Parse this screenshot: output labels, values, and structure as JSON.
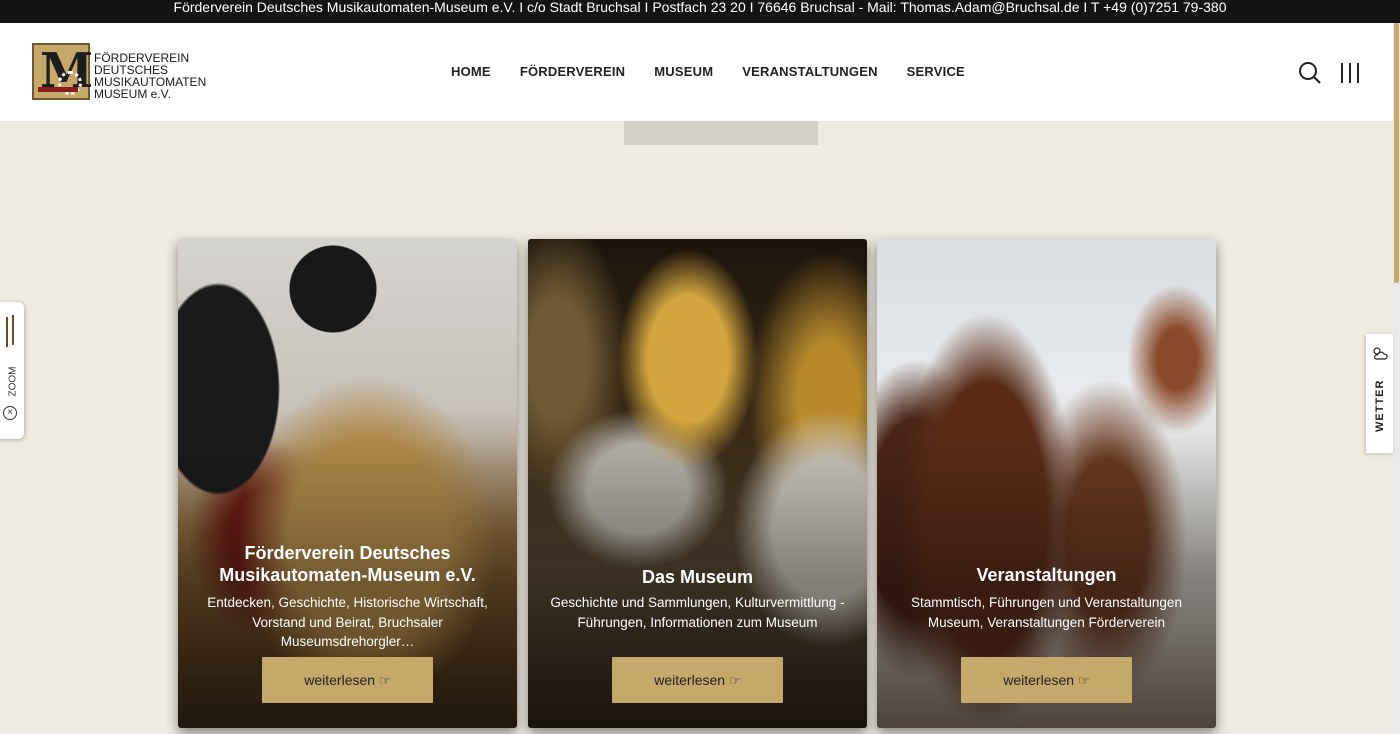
{
  "topbar": {
    "text": "Förderverein Deutsches Musikautomaten-Museum e.V. I c/o Stadt Bruchsal I Postfach 23 20 I 76646 Bruchsal - Mail: Thomas.Adam@Bruchsal.de I T +49 (0)7251 79-380"
  },
  "logo": {
    "line1": "FÖRDERVEREIN",
    "line2": "DEUTSCHES",
    "line3": "MUSIKAUTOMATEN",
    "line4": "MUSEUM e.V."
  },
  "nav": {
    "items": [
      "HOME",
      "FÖRDERVEREIN",
      "MUSEUM",
      "VERANSTALTUNGEN",
      "SERVICE"
    ]
  },
  "zoom_tab": {
    "label": "ZOOM"
  },
  "weather_tab": {
    "label": "WETTER"
  },
  "cards": [
    {
      "title": "Förderverein Deutsches Musikautomaten-Museum e.V.",
      "description": "Entdecken, Geschichte, Historische Wirtschaft, Vorstand und Beirat, Bruchsaler Museumsdrehorgler…",
      "button": "weiterlesen"
    },
    {
      "title": "Das Museum",
      "description": "Geschichte und Sammlungen, Kulturvermittlung - Führungen, Informationen zum Museum",
      "button": "weiterlesen"
    },
    {
      "title": "Veranstaltungen",
      "description": "Stammtisch, Führungen und Veranstaltungen Museum, Veranstaltungen Förderverein",
      "button": "weiterlesen"
    }
  ],
  "colors": {
    "accent": "#c5a96a",
    "topbar_bg": "#141414",
    "page_bg": "#f0ebe0"
  },
  "icons": {
    "search": "search-icon",
    "menu": "menu-icon",
    "hand": "hand-pointing-icon",
    "weather": "weather-icon"
  }
}
